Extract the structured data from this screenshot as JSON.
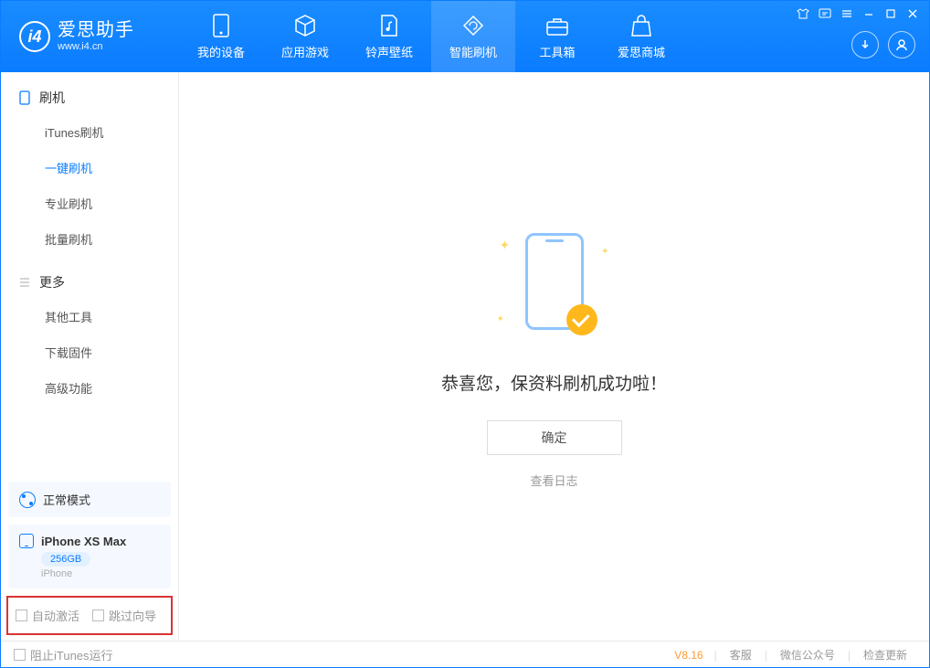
{
  "app": {
    "title": "爱思助手",
    "url": "www.i4.cn"
  },
  "tabs": {
    "device": "我的设备",
    "apps": "应用游戏",
    "ringtones": "铃声壁纸",
    "flash": "智能刷机",
    "toolbox": "工具箱",
    "store": "爱思商城"
  },
  "sidebar": {
    "section1": {
      "title": "刷机",
      "items": [
        "iTunes刷机",
        "一键刷机",
        "专业刷机",
        "批量刷机"
      ]
    },
    "section2": {
      "title": "更多",
      "items": [
        "其他工具",
        "下载固件",
        "高级功能"
      ]
    }
  },
  "device": {
    "mode": "正常模式",
    "name": "iPhone XS Max",
    "storage": "256GB",
    "type": "iPhone"
  },
  "options": {
    "auto_activate": "自动激活",
    "skip_guide": "跳过向导"
  },
  "main": {
    "success_msg": "恭喜您，保资料刷机成功啦！",
    "ok": "确定",
    "view_log": "查看日志"
  },
  "footer": {
    "block_itunes": "阻止iTunes运行",
    "version": "V8.16",
    "support": "客服",
    "wechat": "微信公众号",
    "update": "检查更新"
  }
}
